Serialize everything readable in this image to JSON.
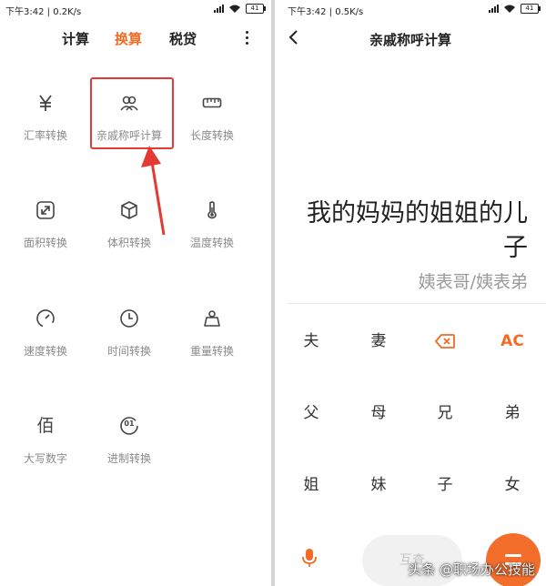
{
  "left_screen": {
    "status": {
      "time": "下午3:42",
      "speed": "0.2K/s",
      "battery": "41"
    },
    "tabs": [
      {
        "label": "计算",
        "active": false
      },
      {
        "label": "换算",
        "active": true
      },
      {
        "label": "税贷",
        "active": false
      }
    ],
    "tiles": [
      {
        "label": "汇率转换",
        "icon": "yen-icon"
      },
      {
        "label": "亲戚称呼计算",
        "icon": "people-icon"
      },
      {
        "label": "长度转换",
        "icon": "ruler-icon"
      },
      {
        "label": "面积转换",
        "icon": "area-icon"
      },
      {
        "label": "体积转换",
        "icon": "cube-icon"
      },
      {
        "label": "温度转换",
        "icon": "thermometer-icon"
      },
      {
        "label": "速度转换",
        "icon": "speedometer-icon"
      },
      {
        "label": "时间转换",
        "icon": "clock-icon"
      },
      {
        "label": "重量转换",
        "icon": "weight-icon"
      },
      {
        "label": "大写数字",
        "icon_text": "佰"
      },
      {
        "label": "进制转换",
        "icon": "binary-icon",
        "icon_text": "01"
      }
    ]
  },
  "right_screen": {
    "status": {
      "time": "下午3:42",
      "speed": "0.5K/s",
      "battery": "41"
    },
    "title": "亲戚称呼计算",
    "expression": "我的妈妈的姐姐的儿子",
    "result": "姨表哥/姨表弟",
    "keys": [
      [
        "夫",
        "妻",
        "⌫",
        "AC"
      ],
      [
        "父",
        "母",
        "兄",
        "弟"
      ],
      [
        "姐",
        "妹",
        "子",
        "女"
      ]
    ],
    "mutual_button": "互查"
  },
  "watermark": "头条 @职场办公技能",
  "colors": {
    "accent": "#f26b25",
    "annotation_red": "#e53935"
  }
}
